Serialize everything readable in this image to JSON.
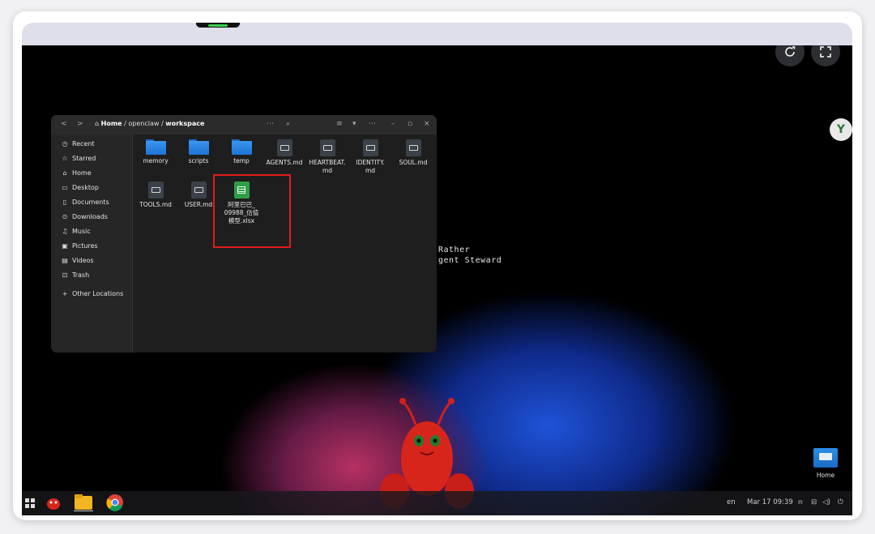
{
  "browser": {
    "reload_icon": "reload-icon",
    "fullscreen_icon": "fullscreen-icon"
  },
  "extension_badge": "Y",
  "wallpaper_text": {
    "line1": "Rather",
    "line2": "gent Steward"
  },
  "file_manager": {
    "breadcrumb": {
      "home": "Home",
      "sep1": "/",
      "folder": "openclaw",
      "sep2": "/",
      "current": "workspace"
    },
    "sidebar": [
      {
        "icon": "clock-icon",
        "glyph": "◷",
        "label": "Recent"
      },
      {
        "icon": "star-icon",
        "glyph": "☆",
        "label": "Starred"
      },
      {
        "icon": "home-icon",
        "glyph": "⌂",
        "label": "Home"
      },
      {
        "icon": "desktop-icon",
        "glyph": "▭",
        "label": "Desktop"
      },
      {
        "icon": "documents-icon",
        "glyph": "▯",
        "label": "Documents"
      },
      {
        "icon": "downloads-icon",
        "glyph": "⊙",
        "label": "Downloads"
      },
      {
        "icon": "music-icon",
        "glyph": "♫",
        "label": "Music"
      },
      {
        "icon": "pictures-icon",
        "glyph": "▣",
        "label": "Pictures"
      },
      {
        "icon": "videos-icon",
        "glyph": "▤",
        "label": "Videos"
      },
      {
        "icon": "trash-icon",
        "glyph": "⊡",
        "label": "Trash"
      },
      {
        "icon": "plus-icon",
        "glyph": "+",
        "label": "Other Locations"
      }
    ],
    "files": [
      {
        "type": "folder",
        "name": "memory"
      },
      {
        "type": "folder",
        "name": "scripts"
      },
      {
        "type": "folder",
        "name": "temp"
      },
      {
        "type": "md",
        "name": "AGENTS.md"
      },
      {
        "type": "md",
        "name": "HEARTBEAT.\nmd"
      },
      {
        "type": "md",
        "name": "IDENTITY.\nmd"
      },
      {
        "type": "md",
        "name": "SOUL.md"
      },
      {
        "type": "md",
        "name": "TOOLS.md"
      },
      {
        "type": "md",
        "name": "USER.md"
      },
      {
        "type": "xlsx",
        "name": "阿里巴巴_\n09988_估值\n模型.xlsx"
      }
    ]
  },
  "desktop": {
    "home_label": "Home"
  },
  "taskbar": {
    "lang": "en",
    "datetime": "Mar 17  09:39"
  },
  "colors": {
    "selection": "#e21b1b",
    "folder": "#2a87e6",
    "xlsx": "#2f9e44"
  }
}
